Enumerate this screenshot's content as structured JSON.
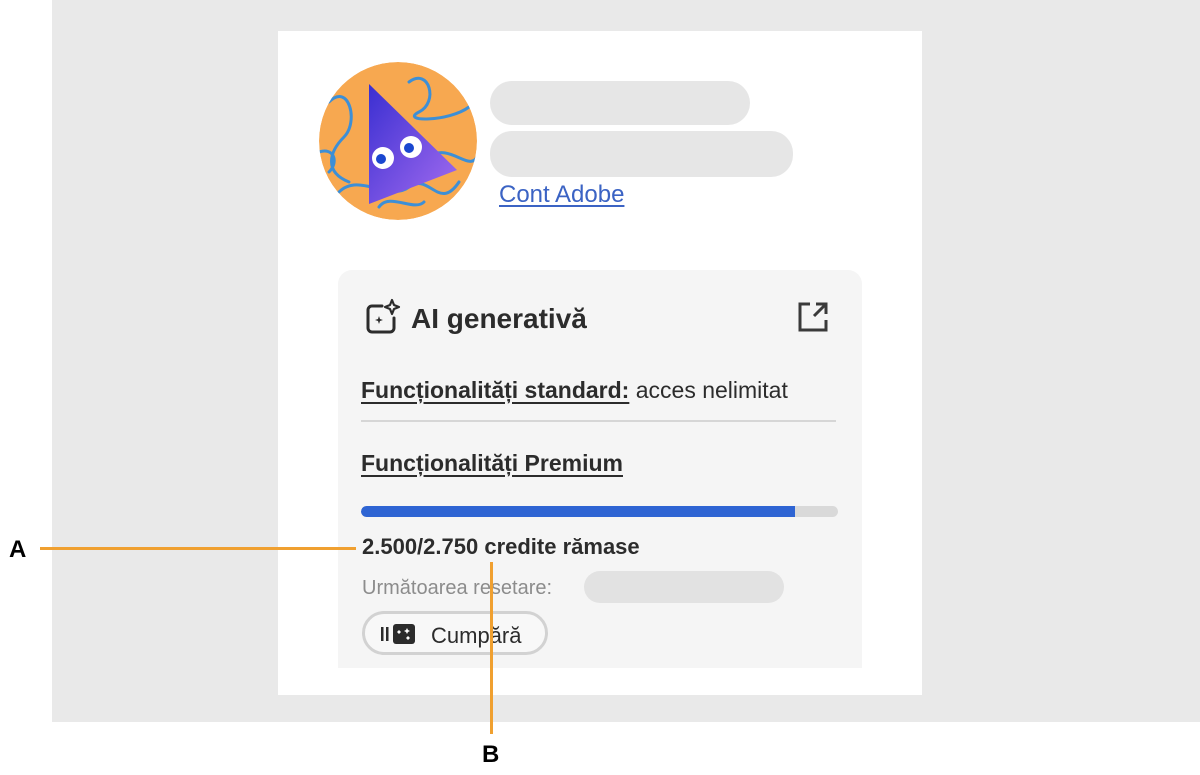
{
  "account": {
    "link_label": "Cont Adobe"
  },
  "generative_ai": {
    "title": "AI generativă",
    "standard_label": "Funcționalități standard:",
    "standard_value": "acces nelimitat",
    "premium_label": "Funcționalități Premium",
    "credits_text": "2.500/2.750 credite rămase",
    "credits_remaining": 2500,
    "credits_total": 2750,
    "progress_fraction": 0.909,
    "next_reset_label": "Următoarea resetare:",
    "buy_label": "Cumpără"
  },
  "callouts": {
    "a": "A",
    "b": "B"
  },
  "colors": {
    "accent": "#2e64d3",
    "link": "#3b63c4",
    "callout": "#f0a030",
    "avatar_bg": "#f7a850"
  },
  "icons": {
    "ai": "sparkle-icon",
    "external": "external-link-icon",
    "buy": "credits-icon"
  }
}
